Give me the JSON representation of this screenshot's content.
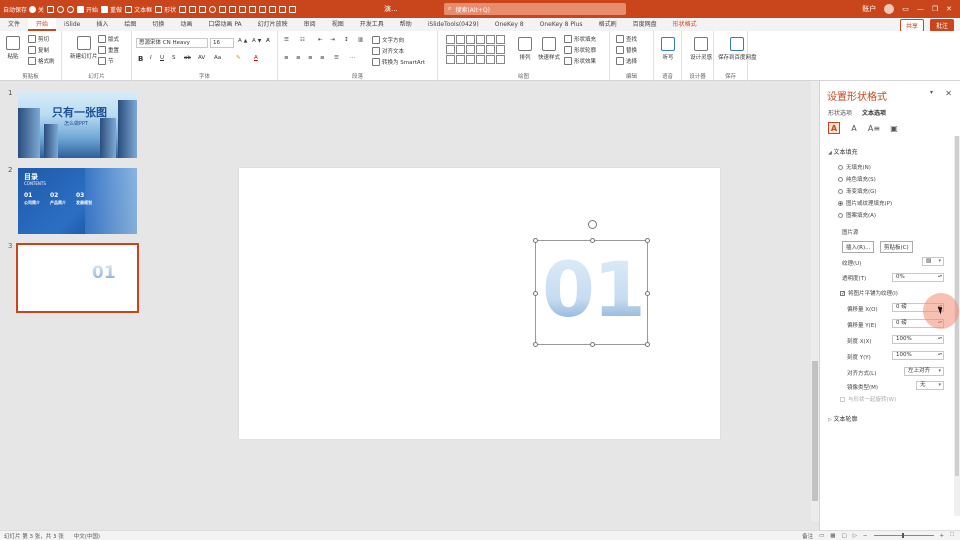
{
  "titlebar": {
    "quick_access": [
      "自动保存",
      "关",
      "开始",
      "重做",
      "文本框",
      "形状"
    ],
    "doc_title": "演...",
    "search_placeholder": "搜索(Alt+Q)",
    "user": "账户",
    "window_controls": [
      "—",
      "❐",
      "✕"
    ]
  },
  "tabs": [
    "文件",
    "开始",
    "iSlide",
    "插入",
    "绘图",
    "切换",
    "动画",
    "口袋动画 PA",
    "幻灯片放映",
    "审阅",
    "视图",
    "开发工具",
    "帮助",
    "iSlideTools(0429)",
    "OneKey 8",
    "OneKey 8 Plus",
    "格式刷",
    "百度网盘",
    "形状格式"
  ],
  "active_tab": "开始",
  "context_tab": "形状格式",
  "share": {
    "share": "共享",
    "comment": "批注"
  },
  "ribbon": {
    "groups": [
      "剪贴板",
      "幻灯片",
      "字体",
      "段落",
      "绘图",
      "编辑",
      "语音",
      "设计器",
      "保存"
    ],
    "paste": "粘贴",
    "cut": "剪切",
    "copy": "复制",
    "format_painter": "格式刷",
    "new_slide": "新建幻灯片",
    "layout": "版式",
    "reset": "重置",
    "section": "节",
    "font_name": "思源宋体 CN Heavy",
    "font_size": "16",
    "text_direction": "文字方向",
    "align_text": "对齐文本",
    "smartart": "转换为 SmartArt",
    "arrange": "排列",
    "quick_styles": "快速样式",
    "shape_fill": "形状填充",
    "shape_outline": "形状轮廓",
    "shape_effects": "形状效果",
    "find": "查找",
    "replace": "替换",
    "select": "选择",
    "dictate": "听写",
    "designer": "设计灵感",
    "save_baidu": "保存到百度网盘"
  },
  "thumbnails": [
    {
      "num": "1",
      "title": "只有一张图",
      "subtitle": "怎么做PPT"
    },
    {
      "num": "2",
      "title": "目录",
      "subtitle": "CONTENTS",
      "items": [
        "01",
        "02",
        "03"
      ],
      "item_labels": [
        "公司简介",
        "产品简介",
        "发展规划"
      ]
    },
    {
      "num": "3",
      "text": "01"
    }
  ],
  "slide": {
    "text": "01"
  },
  "format_pane": {
    "title": "设置形状格式",
    "subtabs": [
      "形状选项",
      "文本选项"
    ],
    "section_fill": "文本填充",
    "fill_options": [
      "无填充(N)",
      "纯色填充(S)",
      "渐变填充(G)",
      "图片或纹理填充(P)",
      "图案填充(A)"
    ],
    "selected_fill": "图片或纹理填充(P)",
    "picture_source": "图片源",
    "insert_btn": "插入(R)...",
    "clipboard_btn": "剪贴板(C)",
    "texture_label": "纹理(U)",
    "transparency_label": "透明度(T)",
    "transparency_value": "0%",
    "tile_label": "将图片平铺为纹理(I)",
    "offset_x_label": "偏移量 X(O)",
    "offset_x_value": "0 磅",
    "offset_y_label": "偏移量 Y(E)",
    "offset_y_value": "0 磅",
    "scale_x_label": "刻度 X(X)",
    "scale_x_value": "100%",
    "scale_y_label": "刻度 Y(Y)",
    "scale_y_value": "100%",
    "alignment_label": "对齐方式(L)",
    "alignment_value": "左上对齐",
    "mirror_label": "镜像类型(M)",
    "mirror_value": "无",
    "rotate_with_shape": "与形状一起旋转(W)",
    "section_outline": "文本轮廓"
  },
  "statusbar": {
    "slide_info": "幻灯片 第 3 张，共 3 张",
    "language": "中文(中国)",
    "notes": "备注",
    "zoom_minus": "−",
    "zoom_plus": "+"
  },
  "colors": {
    "accent": "#c9461d",
    "selected_thumb_border": "#c9461d"
  }
}
